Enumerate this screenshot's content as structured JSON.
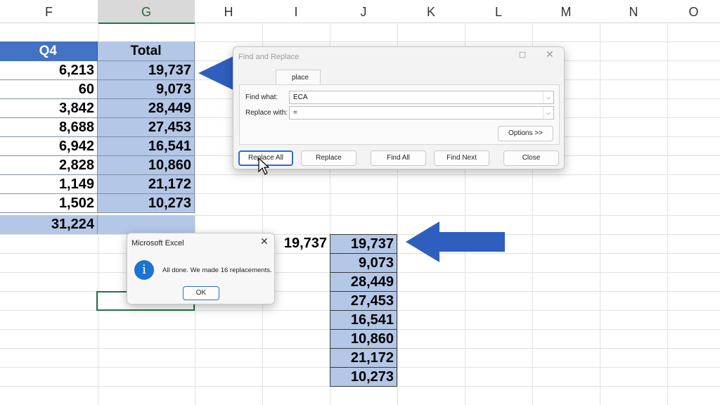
{
  "columns": [
    "F",
    "G",
    "H",
    "I",
    "J",
    "K",
    "L",
    "M",
    "N",
    "O"
  ],
  "table": {
    "q4_header": "Q4",
    "total_header": "Total",
    "q4_values": [
      "6,213",
      "60",
      "3,842",
      "8,688",
      "6,942",
      "2,828",
      "1,149",
      "1,502"
    ],
    "total_values": [
      "19,737",
      "9,073",
      "28,449",
      "27,453",
      "16,541",
      "10,860",
      "21,172",
      "10,273"
    ],
    "q4_sum": "31,224"
  },
  "second_table": {
    "i_value": "19,737",
    "j_values": [
      "19,737",
      "9,073",
      "28,449",
      "27,453",
      "16,541",
      "10,860",
      "21,172",
      "10,273"
    ]
  },
  "find_replace": {
    "title": "Find and Replace",
    "tab_partial": "place",
    "find_what_label": "Find what:",
    "find_what_value": "ECA",
    "replace_with_label": "Replace with:",
    "replace_with_value": "=",
    "options_button": "Options >>",
    "replace_all_button": "Replace All",
    "replace_button": "Replace",
    "find_all_button": "Find All",
    "find_next_button": "Find Next",
    "close_button": "Close"
  },
  "message_box": {
    "title": "Microsoft Excel",
    "message": "All done. We made 16 replacements.",
    "ok_button": "OK",
    "icon": "info-icon"
  },
  "colors": {
    "header_blue": "#4472c4",
    "cell_blue": "#b4c7e7",
    "arrow_blue": "#2e5fbf"
  }
}
